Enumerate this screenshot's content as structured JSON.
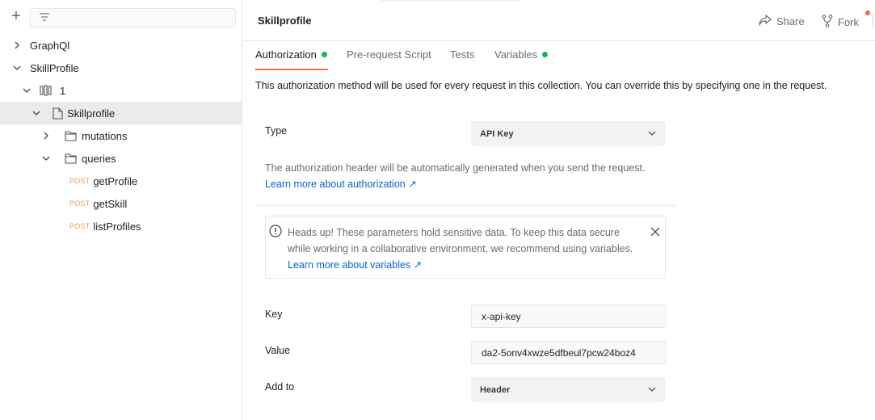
{
  "sidebar": {
    "tree": [
      {
        "label": "GraphQl"
      },
      {
        "label": "SkillProfile"
      },
      {
        "label": "1"
      },
      {
        "label": "Skillprofile"
      },
      {
        "label": "mutations"
      },
      {
        "label": "queries"
      },
      {
        "method": "POST",
        "label": "getProfile"
      },
      {
        "method": "POST",
        "label": "getSkill"
      },
      {
        "method": "POST",
        "label": "listProfiles"
      }
    ]
  },
  "header": {
    "title": "Skillprofile",
    "share_label": "Share",
    "fork_label": "Fork"
  },
  "tabs": [
    {
      "label": "Authorization",
      "dot": true
    },
    {
      "label": "Pre-request Script",
      "dot": false
    },
    {
      "label": "Tests",
      "dot": false
    },
    {
      "label": "Variables",
      "dot": true
    }
  ],
  "auth": {
    "description": "This authorization method will be used for every request in this collection. You can override this by specifying one in the request.",
    "type_label": "Type",
    "type_value": "API Key",
    "help_text": "The authorization header will be automatically generated when you send the request.",
    "help_link": "Learn more about authorization ↗",
    "alert_text": "Heads up! These parameters hold sensitive data. To keep this data secure while working in a collaborative environment, we recommend using variables.",
    "alert_link": "Learn more about variables ↗",
    "key_label": "Key",
    "key_value": "x-api-key",
    "value_label": "Value",
    "value_value": "da2-5onv4xwze5dfbeul7pcw24boz4",
    "addto_label": "Add to",
    "addto_value": "Header"
  },
  "colors": {
    "accent": "#ff6c37",
    "success_dot": "#0cbb52",
    "post_method": "#e9a05a",
    "link": "#0265d2"
  }
}
